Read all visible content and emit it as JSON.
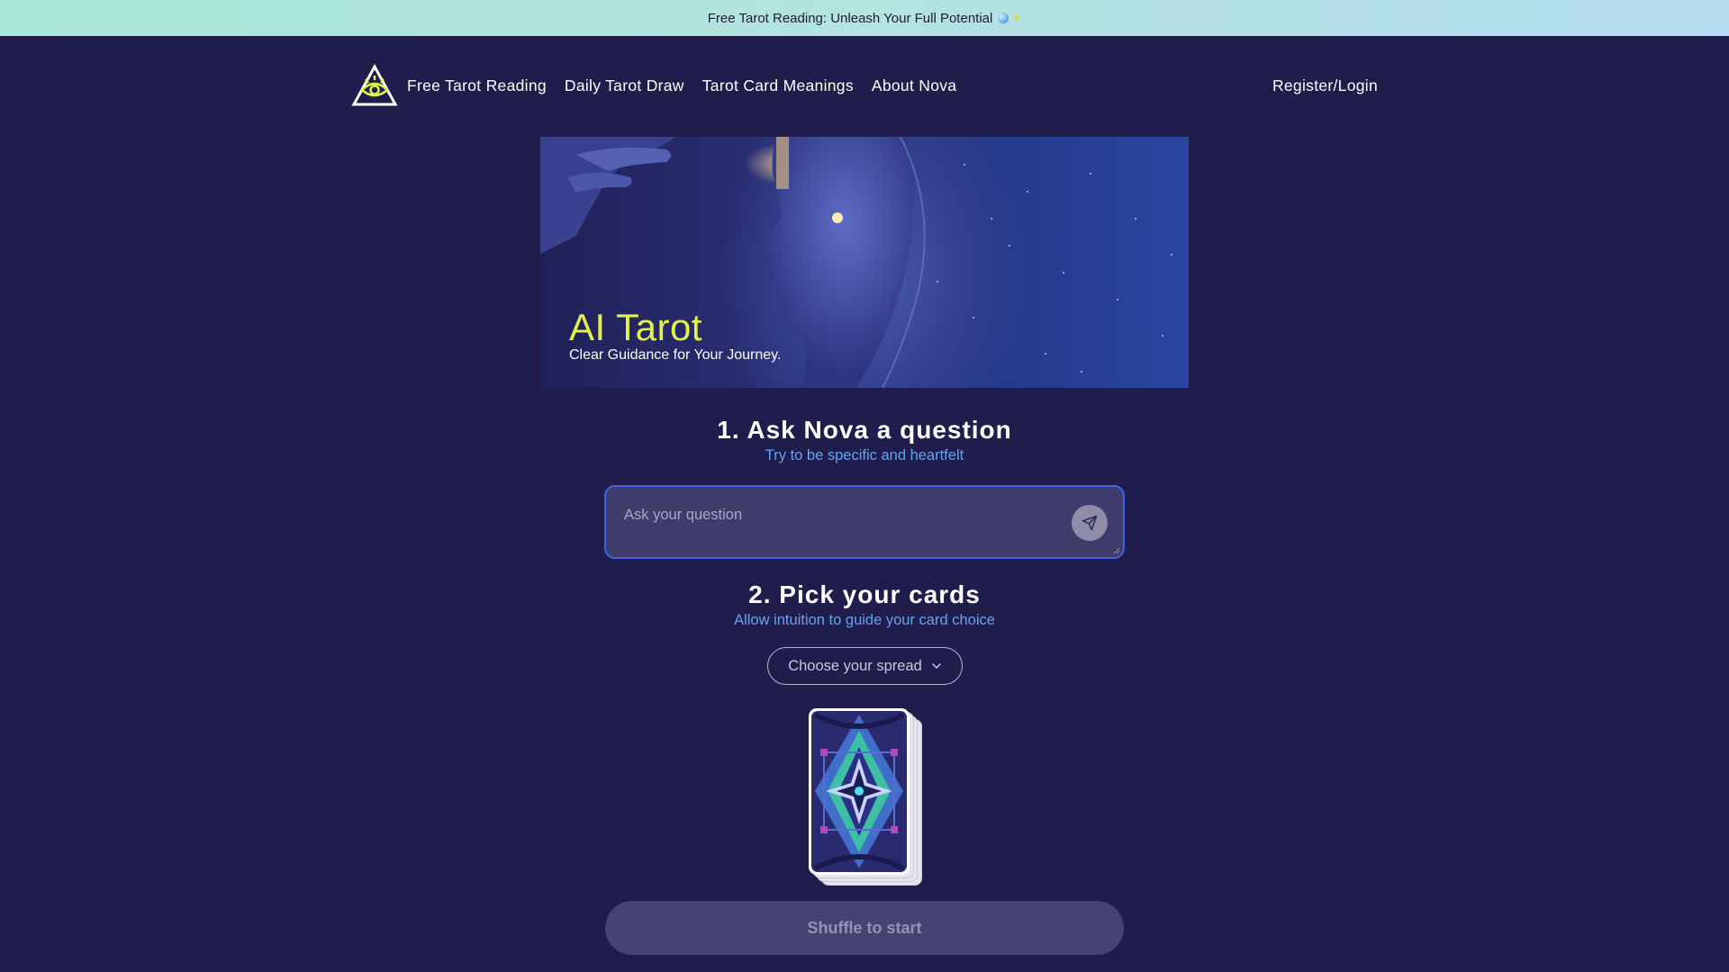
{
  "banner": {
    "text": "Free Tarot Reading: Unleash Your Full Potential",
    "icons": [
      "crystal-ball-icon",
      "sparkles-icon"
    ]
  },
  "nav": {
    "logo_icon": "all-seeing-eye-logo-icon",
    "links": [
      {
        "label": "Free Tarot Reading"
      },
      {
        "label": "Daily Tarot Draw"
      },
      {
        "label": "Tarot Card Meanings"
      },
      {
        "label": "About Nova"
      }
    ],
    "account_label": "Register/Login"
  },
  "hero": {
    "title": "AI Tarot",
    "subtitle": "Clear Guidance for Your Journey."
  },
  "step1": {
    "title": "1. Ask Nova a question",
    "subtitle": "Try to be specific and heartfelt",
    "input_placeholder": "Ask your question",
    "input_value": "",
    "send_icon": "paper-plane-icon"
  },
  "step2": {
    "title": "2. Pick your cards",
    "subtitle": "Allow intuition to guide your card choice",
    "spread_select": "Choose your spread",
    "chevron_icon": "chevron-down-icon"
  },
  "shuffle_button": "Shuffle to start",
  "colors": {
    "background": "#201c4c",
    "accent_yellow": "#e2f24a",
    "link_blue": "#63a5f2",
    "input_border": "#3d63e8",
    "button_disabled": "#454374"
  }
}
